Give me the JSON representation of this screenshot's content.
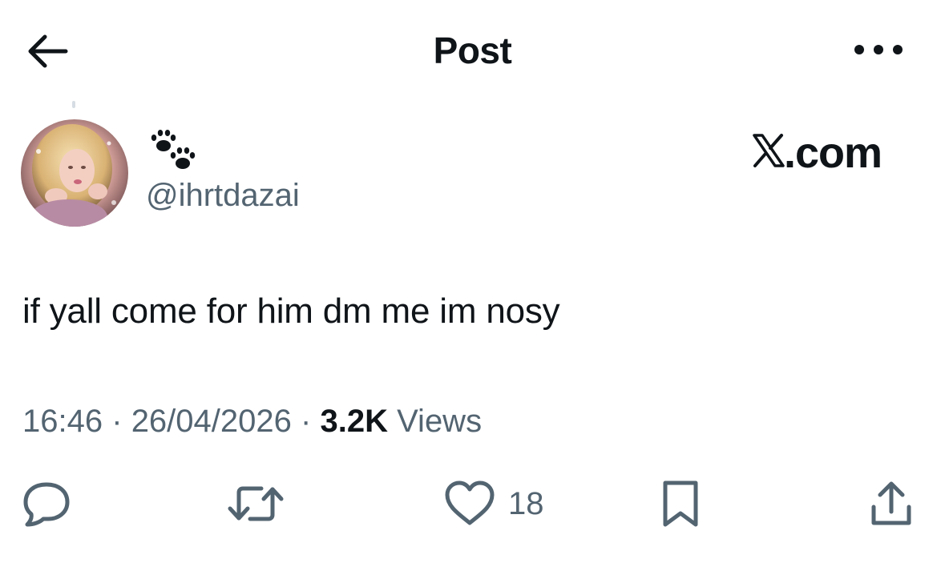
{
  "header": {
    "title": "Post",
    "back_icon": "arrow-left-icon",
    "more_icon": "ellipsis-icon"
  },
  "author": {
    "display_name_icon": "paw-prints-icon",
    "handle": "@ihrtdazai"
  },
  "source": {
    "label": ".com",
    "logo_icon": "x-logo-icon"
  },
  "post": {
    "text": "if yall come for him dm me im nosy"
  },
  "meta": {
    "time": "16:46",
    "separator": "·",
    "date": "26/04/2026",
    "views_count": "3.2K",
    "views_label": "Views"
  },
  "actions": {
    "reply_icon": "reply-icon",
    "repost_icon": "repost-icon",
    "like_icon": "heart-icon",
    "like_count": "18",
    "bookmark_icon": "bookmark-icon",
    "share_icon": "share-icon"
  },
  "colors": {
    "text_primary": "#0f1419",
    "text_secondary": "#536471",
    "background": "#ffffff"
  }
}
